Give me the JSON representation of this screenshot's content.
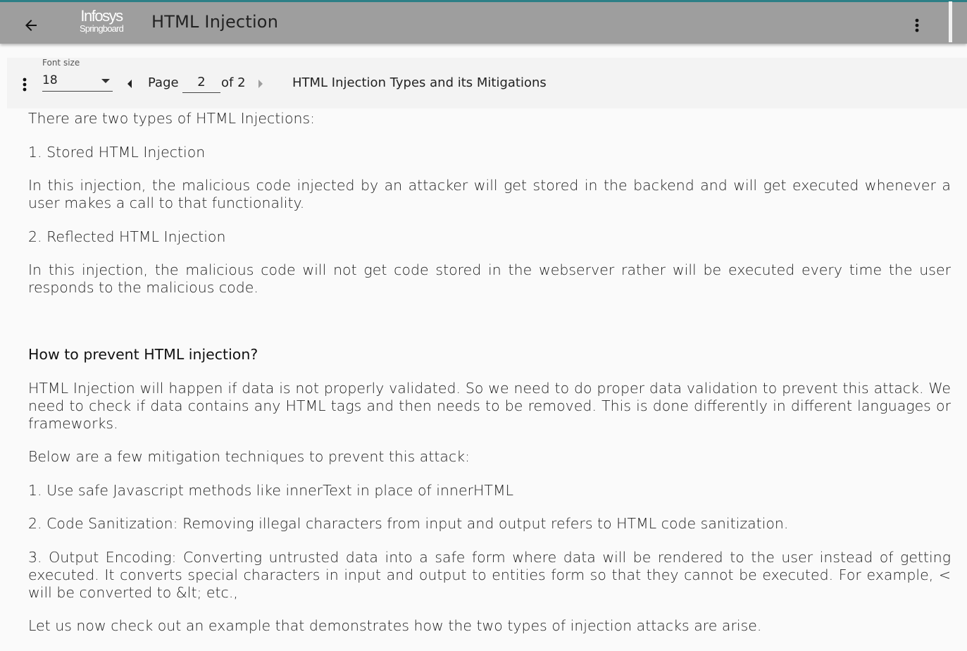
{
  "app_bar": {
    "title": "HTML Injection",
    "logo_line1": "Infosys",
    "logo_line2": "Springboard",
    "back_icon": "arrow-left-icon",
    "menu_icon": "more-vert-icon"
  },
  "toolbar": {
    "menu_icon": "more-vert-icon",
    "font_size_label": "Font size",
    "font_size_value": "18",
    "page_label": "Page",
    "page_value": "2",
    "page_total": "of 2",
    "prev_icon": "caret-left-icon",
    "next_icon": "caret-right-icon",
    "document_title": "HTML Injection Types and its Mitigations"
  },
  "content": {
    "p1": "There are two types of HTML Injections:",
    "p2": "1. Stored HTML Injection",
    "p3": "In this injection, the malicious code injected by an attacker will get stored in the backend and will get executed whenever a user makes a call to that functionality.",
    "p4": "2. Reflected HTML Injection",
    "p5": "In this injection, the malicious code will not get code stored in the webserver rather will be executed every time the user responds to the malicious code.",
    "heading": "How to prevent HTML injection?",
    "p6": "HTML Injection will happen if data is not properly validated. So we need to do proper data validation to prevent this attack. We need to check if data contains any HTML tags and then needs to be removed. This is done differently in different languages or frameworks.",
    "p7": "Below are a few mitigation techniques to prevent this attack:",
    "p8": "1. Use safe Javascript methods like innerText in place of innerHTML",
    "p9": "2. Code Sanitization: Removing illegal characters from input and output refers to HTML code sanitization.",
    "p10": "3. Output Encoding: Converting untrusted data into a safe form where data will be rendered to the user instead of getting executed. It converts special characters in input and output to entities form so that they cannot be executed. For example, < will be converted to &lt; etc.,",
    "p11": "Let us now check out an example that demonstrates how the two types of injection attacks are arise."
  },
  "colors": {
    "app_bar_bg": "#9e9e9e",
    "top_accent": "#2d7f86",
    "page_bg": "#fafafa",
    "toolbar_bg": "#f3f3f3"
  }
}
